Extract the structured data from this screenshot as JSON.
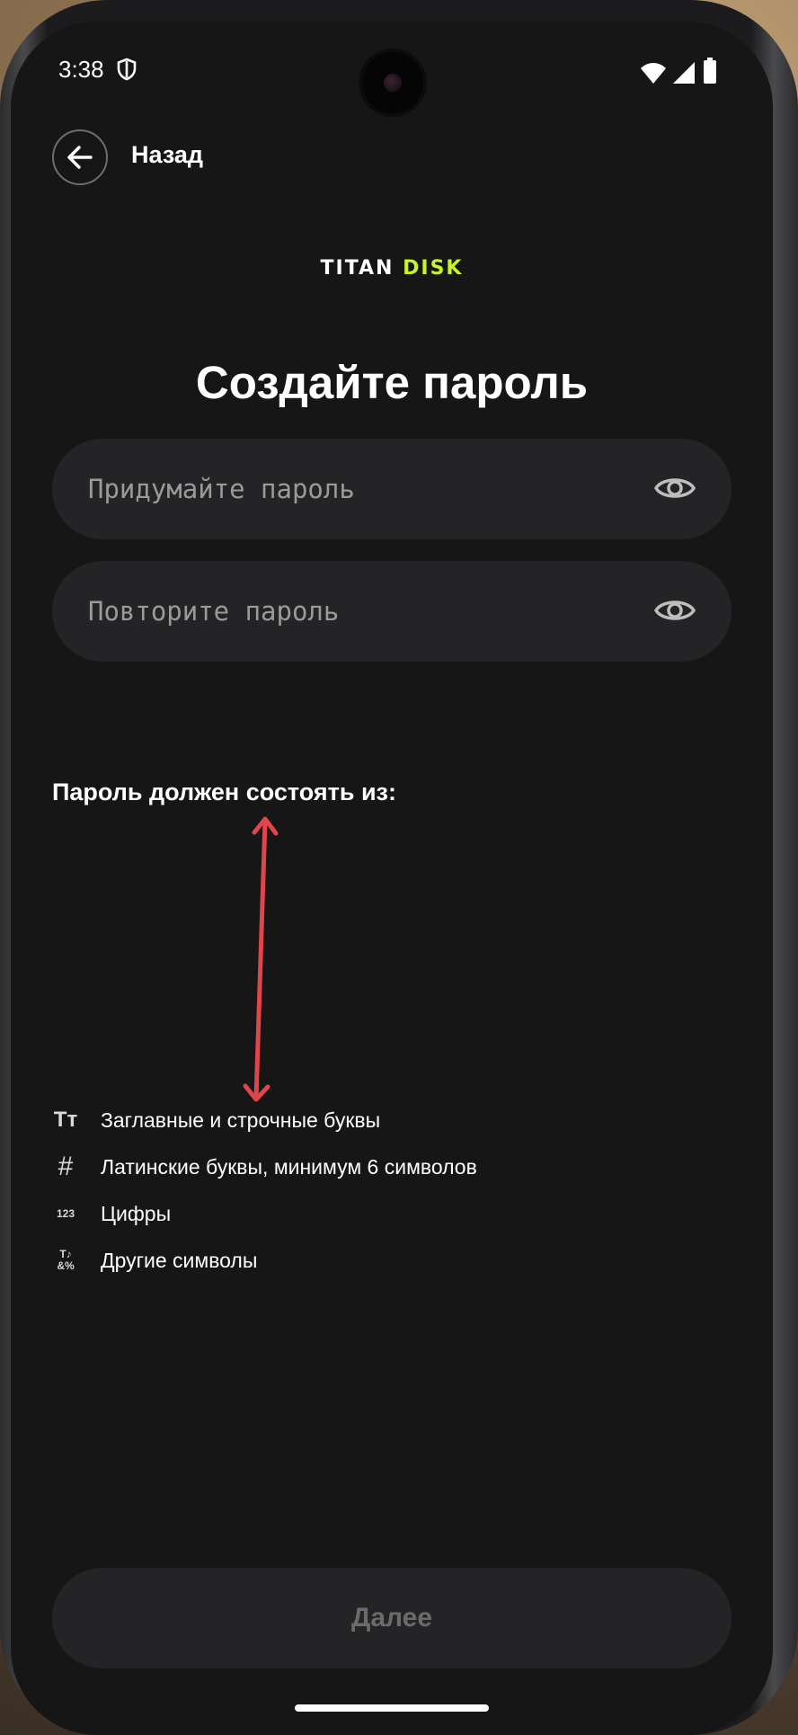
{
  "status_bar": {
    "time": "3:38"
  },
  "header": {
    "back_label": "Назад"
  },
  "logo": {
    "part1": "TITAN",
    "part2": "DISK",
    "accent_color": "#c6f425"
  },
  "title": "Создайте пароль",
  "fields": {
    "password_placeholder": "Придумайте пароль",
    "repeat_placeholder": "Повторите пароль"
  },
  "rules": {
    "title": "Пароль должен состоять из:",
    "items": [
      {
        "icon": "text-case-icon",
        "glyph": "Tт",
        "label": "Заглавные и строчные буквы"
      },
      {
        "icon": "hash-icon",
        "glyph": "#",
        "label": "Латинские буквы, минимум 6 символов"
      },
      {
        "icon": "numbers-icon",
        "glyph": "123",
        "label": "Цифры"
      },
      {
        "icon": "symbols-icon",
        "glyph": "T♪&%",
        "label": "Другие символы"
      }
    ]
  },
  "next_button": {
    "label": "Далее"
  },
  "colors": {
    "background": "#161616",
    "field": "#242426",
    "annotation_arrow": "#e0454c"
  }
}
